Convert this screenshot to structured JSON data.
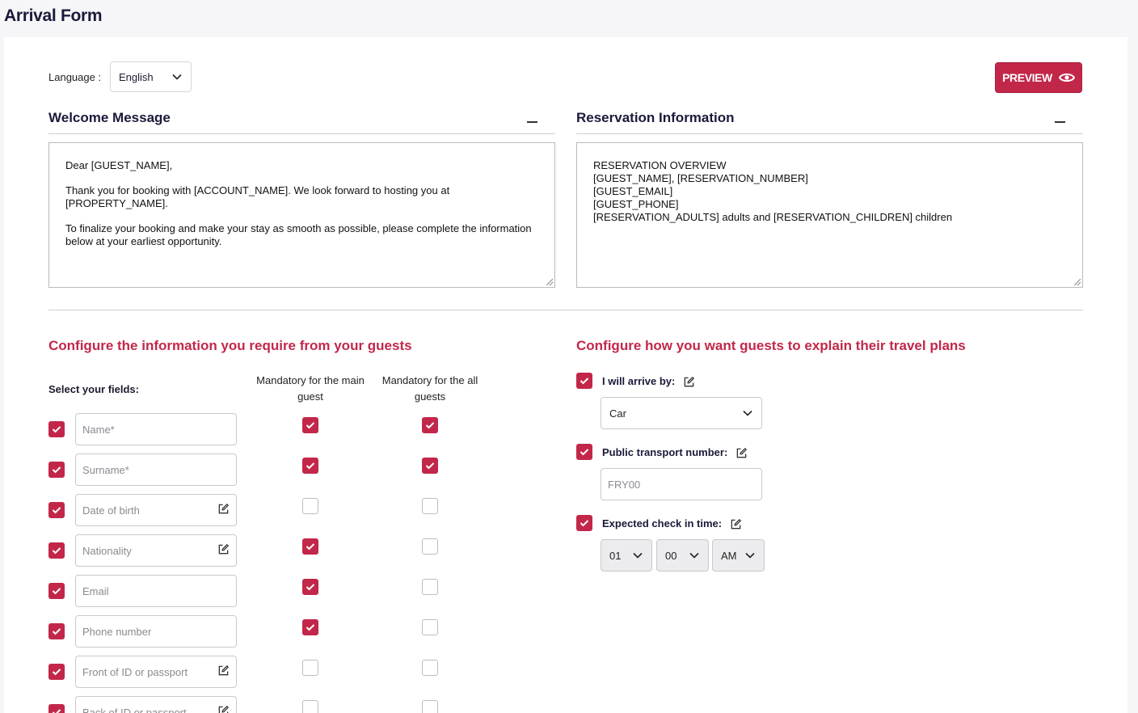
{
  "page": {
    "title": "Arrival Form"
  },
  "toolbar": {
    "language_label": "Language :",
    "language_value": "English",
    "preview_label": "PREVIEW"
  },
  "welcome": {
    "title": "Welcome Message",
    "paragraphs": [
      "Dear [GUEST_NAME],",
      "Thank you for booking with [ACCOUNT_NAME]. We look forward to hosting you at [PROPERTY_NAME].",
      "To finalize your booking and make your stay as smooth as possible, please complete the information below at your earliest opportunity."
    ]
  },
  "reservation": {
    "title": "Reservation Information",
    "lines": [
      "RESERVATION OVERVIEW",
      "[GUEST_NAME], [RESERVATION_NUMBER]",
      "[GUEST_EMAIL]",
      "[GUEST_PHONE]",
      "[RESERVATION_ADULTS] adults and [RESERVATION_CHILDREN] children"
    ]
  },
  "guest_config": {
    "title": "Configure the information you require from your guests",
    "select_label": "Select your fields:",
    "col_main": "Mandatory for the main guest",
    "col_all": "Mandatory for the all guests",
    "fields": [
      {
        "placeholder": "Name*",
        "enabled": true,
        "editable": false,
        "main": true,
        "all": true
      },
      {
        "placeholder": "Surname*",
        "enabled": true,
        "editable": false,
        "main": true,
        "all": true
      },
      {
        "placeholder": "Date of birth",
        "enabled": true,
        "editable": true,
        "main": false,
        "all": false
      },
      {
        "placeholder": "Nationality",
        "enabled": true,
        "editable": true,
        "main": true,
        "all": false
      },
      {
        "placeholder": "Email",
        "enabled": true,
        "editable": false,
        "main": true,
        "all": false
      },
      {
        "placeholder": "Phone number",
        "enabled": true,
        "editable": false,
        "main": true,
        "all": false
      },
      {
        "placeholder": "Front of ID or passport",
        "enabled": true,
        "editable": true,
        "main": false,
        "all": false
      },
      {
        "placeholder": "Back of ID or passport",
        "enabled": true,
        "editable": true,
        "main": false,
        "all": false
      }
    ]
  },
  "travel_config": {
    "title": "Configure how you want guests to explain their travel plans",
    "arrive_label": "I will arrive by:",
    "arrive_value": "Car",
    "transport_label": "Public transport number:",
    "transport_placeholder": "FRY00",
    "checkin_label": "Expected check in time:",
    "hour": "01",
    "minute": "00",
    "ampm": "AM"
  },
  "colors": {
    "accent": "#c2274a",
    "heading": "#1a1a3a"
  }
}
